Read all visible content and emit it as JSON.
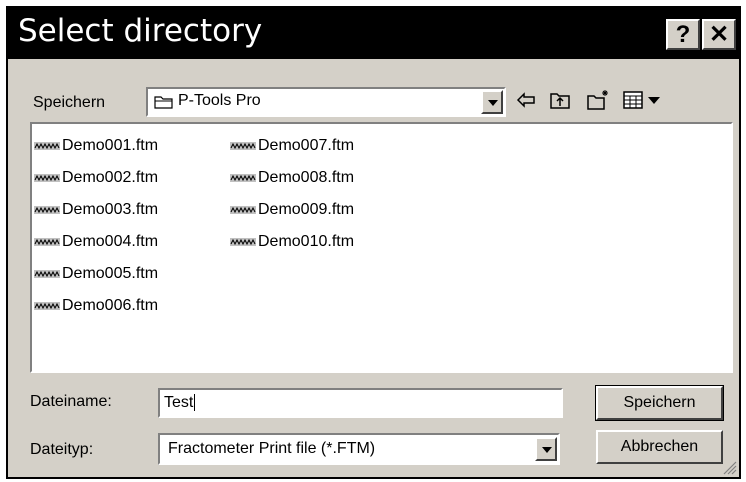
{
  "window": {
    "title": "Select directory",
    "help_label": "?",
    "close_label": "✕"
  },
  "save_in": {
    "label": "Speichern",
    "folder": "P-Tools Pro"
  },
  "toolbar": {
    "icons": [
      "back-icon",
      "up-folder-icon",
      "new-folder-icon",
      "view-menu-icon"
    ]
  },
  "files": {
    "col1": [
      "Demo001.ftm",
      "Demo002.ftm",
      "Demo003.ftm",
      "Demo004.ftm",
      "Demo005.ftm",
      "Demo006.ftm"
    ],
    "col2": [
      "Demo007.ftm",
      "Demo008.ftm",
      "Demo009.ftm",
      "Demo010.ftm"
    ]
  },
  "filename": {
    "label": "Dateiname:",
    "value": "Test"
  },
  "filetype": {
    "label": "Dateityp:",
    "value": "Fractometer Print file (*.FTM)"
  },
  "buttons": {
    "save": "Speichern",
    "cancel": "Abbrechen"
  },
  "colors": {
    "face": "#d4d0c8",
    "titlebar": "#000000"
  }
}
